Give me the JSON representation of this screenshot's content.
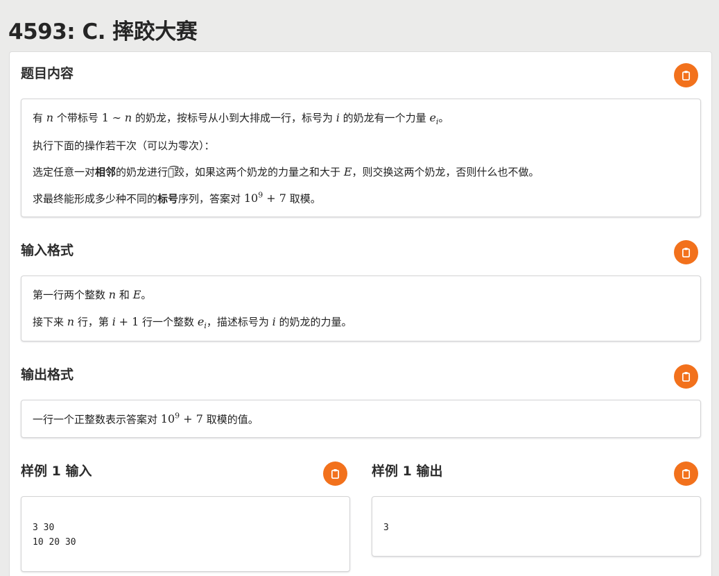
{
  "title": "4593: C. 摔跤大赛",
  "accent_color": "#f2711c",
  "copy_icon": "clipboard-icon",
  "sections": {
    "description": {
      "title": "题目内容",
      "line1": {
        "a": "有",
        "n": "n",
        "b": "个带标号",
        "range_start": "1",
        "tilde": "∼",
        "range_end": "n",
        "c": "的奶龙，按标号从小到大排成一行，标号为",
        "i": "i",
        "d": "的奶龙有一个力量",
        "e": "e",
        "e_sub": "i",
        "end": "。"
      },
      "line2": "执行下面的操作若干次（可以为零次）：",
      "line3": {
        "a": "选定任意一对",
        "bold": "相邻",
        "b": "的奶龙进行摔͡跤，如果这两个奶龙的力量之和大于",
        "E": "E",
        "c": "，则交换这两个奶龙，否则什么也不做。"
      },
      "line4": {
        "a": "求最终能形成多少种不同的",
        "bold": "标号",
        "b": "序列，答案对",
        "base": "10",
        "exp": "9",
        "plus": "+ 7",
        "c": "取模。"
      }
    },
    "input_format": {
      "title": "输入格式",
      "line1": {
        "a": "第一行两个整数",
        "n": "n",
        "b": "和",
        "E": "E",
        "end": "。"
      },
      "line2": {
        "a": "接下来",
        "n": "n",
        "b": "行，第",
        "i": "i",
        "plus": "+ 1",
        "c": "行一个整数",
        "e": "e",
        "e_sub": "i",
        "d": "，描述标号为",
        "i2": "i",
        "end": "的奶龙的力量。"
      }
    },
    "output_format": {
      "title": "输出格式",
      "line1": {
        "a": "一行一个正整数表示答案对",
        "base": "10",
        "exp": "9",
        "plus": "+ 7",
        "c": "取模的值。"
      }
    },
    "sample_input": {
      "title": "样例 1 输入",
      "content": "3 30\n10 20 30"
    },
    "sample_output": {
      "title": "样例 1 输出",
      "content": "3"
    }
  }
}
